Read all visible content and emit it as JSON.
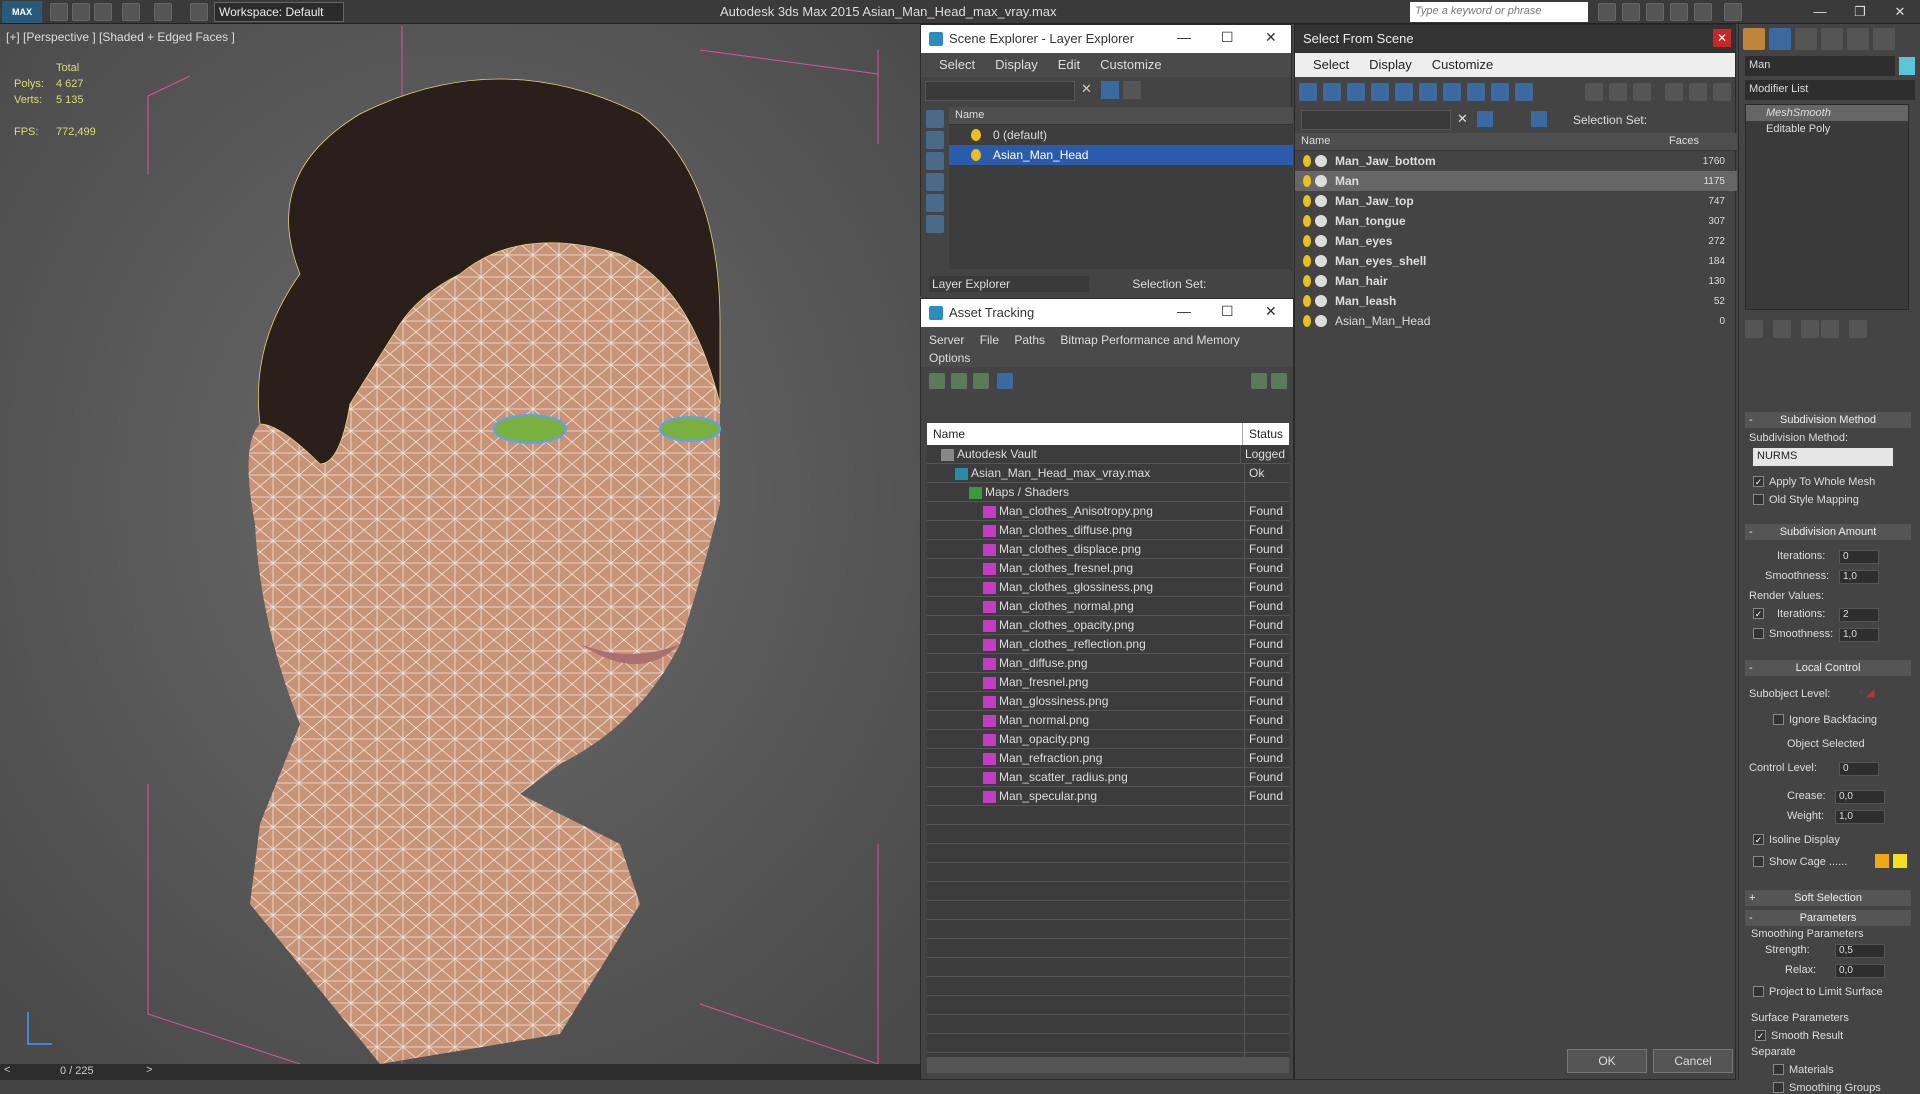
{
  "app": {
    "title": "Autodesk 3ds Max  2015    Asian_Man_Head_max_vray.max",
    "workspace": "Workspace: Default",
    "search_placeholder": "Type a keyword or phrase",
    "logo": "MAX"
  },
  "viewport": {
    "label": "[+] [Perspective ] [Shaded + Edged Faces ]",
    "stats_header": "Total",
    "polys_label": "Polys:",
    "polys": "4 627",
    "verts_label": "Verts:",
    "verts": "5 135",
    "fps_label": "FPS:",
    "fps": "772,499"
  },
  "timeline": {
    "frame": "0 / 225"
  },
  "scene_explorer": {
    "title": "Scene Explorer - Layer Explorer",
    "menu": [
      "Select",
      "Display",
      "Edit",
      "Customize"
    ],
    "col_name": "Name",
    "layers": [
      "0 (default)",
      "Asian_Man_Head"
    ],
    "footer_left": "Layer Explorer",
    "footer_right": "Selection Set:"
  },
  "asset_tracking": {
    "title": "Asset Tracking",
    "menu1": [
      "Server",
      "File",
      "Paths",
      "Bitmap Performance and Memory"
    ],
    "menu2": "Options",
    "col_name": "Name",
    "col_status": "Status",
    "rows": [
      {
        "name": "Autodesk Vault",
        "status": "Logged",
        "indent": 1,
        "type": "vault"
      },
      {
        "name": "Asian_Man_Head_max_vray.max",
        "status": "Ok",
        "indent": 2,
        "type": "max"
      },
      {
        "name": "Maps / Shaders",
        "status": "",
        "indent": 3,
        "type": "folder"
      },
      {
        "name": "Man_clothes_Anisotropy.png",
        "status": "Found",
        "indent": 4,
        "type": "png"
      },
      {
        "name": "Man_clothes_diffuse.png",
        "status": "Found",
        "indent": 4,
        "type": "png"
      },
      {
        "name": "Man_clothes_displace.png",
        "status": "Found",
        "indent": 4,
        "type": "png"
      },
      {
        "name": "Man_clothes_fresnel.png",
        "status": "Found",
        "indent": 4,
        "type": "png"
      },
      {
        "name": "Man_clothes_glossiness.png",
        "status": "Found",
        "indent": 4,
        "type": "png"
      },
      {
        "name": "Man_clothes_normal.png",
        "status": "Found",
        "indent": 4,
        "type": "png"
      },
      {
        "name": "Man_clothes_opacity.png",
        "status": "Found",
        "indent": 4,
        "type": "png"
      },
      {
        "name": "Man_clothes_reflection.png",
        "status": "Found",
        "indent": 4,
        "type": "png"
      },
      {
        "name": "Man_diffuse.png",
        "status": "Found",
        "indent": 4,
        "type": "png"
      },
      {
        "name": "Man_fresnel.png",
        "status": "Found",
        "indent": 4,
        "type": "png"
      },
      {
        "name": "Man_glossiness.png",
        "status": "Found",
        "indent": 4,
        "type": "png"
      },
      {
        "name": "Man_normal.png",
        "status": "Found",
        "indent": 4,
        "type": "png"
      },
      {
        "name": "Man_opacity.png",
        "status": "Found",
        "indent": 4,
        "type": "png"
      },
      {
        "name": "Man_refraction.png",
        "status": "Found",
        "indent": 4,
        "type": "png"
      },
      {
        "name": "Man_scatter_radius.png",
        "status": "Found",
        "indent": 4,
        "type": "png"
      },
      {
        "name": "Man_specular.png",
        "status": "Found",
        "indent": 4,
        "type": "png"
      }
    ]
  },
  "select_from_scene": {
    "title": "Select From Scene",
    "menu": [
      "Select",
      "Display",
      "Customize"
    ],
    "selection_set": "Selection Set:",
    "col_name": "Name",
    "col_faces": "Faces",
    "rows": [
      {
        "name": "Man_Jaw_bottom",
        "faces": "1760"
      },
      {
        "name": "Man",
        "faces": "1175"
      },
      {
        "name": "Man_Jaw_top",
        "faces": "747"
      },
      {
        "name": "Man_tongue",
        "faces": "307"
      },
      {
        "name": "Man_eyes",
        "faces": "272"
      },
      {
        "name": "Man_eyes_shell",
        "faces": "184"
      },
      {
        "name": "Man_hair",
        "faces": "130"
      },
      {
        "name": "Man_leash",
        "faces": "52"
      },
      {
        "name": "Asian_Man_Head",
        "faces": "0"
      }
    ],
    "ok": "OK",
    "cancel": "Cancel"
  },
  "command_panel": {
    "object_name": "Man",
    "modifier_list": "Modifier List",
    "stack": [
      "MeshSmooth",
      "Editable Poly"
    ],
    "subdiv_method_title": "Subdivision Method",
    "subdiv_method_label": "Subdivision Method:",
    "subdiv_method_value": "NURMS",
    "apply_whole": "Apply To Whole Mesh",
    "old_style": "Old Style Mapping",
    "subdiv_amount_title": "Subdivision Amount",
    "iterations_label": "Iterations:",
    "iterations": "0",
    "smoothness_label": "Smoothness:",
    "smoothness": "1,0",
    "render_values": "Render Values:",
    "r_iterations": "2",
    "r_smoothness": "1,0",
    "local_control_title": "Local Control",
    "subobject_level": "Subobject Level:",
    "ignore_backfacing": "Ignore Backfacing",
    "object_selected": "Object Selected",
    "control_level_label": "Control Level:",
    "control_level": "0",
    "crease_label": "Crease:",
    "crease": "0,0",
    "weight_label": "Weight:",
    "weight": "1,0",
    "isoline": "Isoline Display",
    "show_cage": "Show Cage ......",
    "soft_selection_title": "Soft Selection",
    "parameters_title": "Parameters",
    "smoothing_params": "Smoothing Parameters",
    "strength_label": "Strength:",
    "strength": "0,5",
    "relax_label": "Relax:",
    "relax": "0,0",
    "project_limit": "Project to Limit Surface",
    "surface_params": "Surface Parameters",
    "smooth_result": "Smooth Result",
    "separate": "Separate",
    "materials": "Materials",
    "smoothing_groups": "Smoothing Groups"
  },
  "colors": {
    "cage1": "#f0a818",
    "cage2": "#f0e020",
    "selection": "#2a5cab"
  }
}
